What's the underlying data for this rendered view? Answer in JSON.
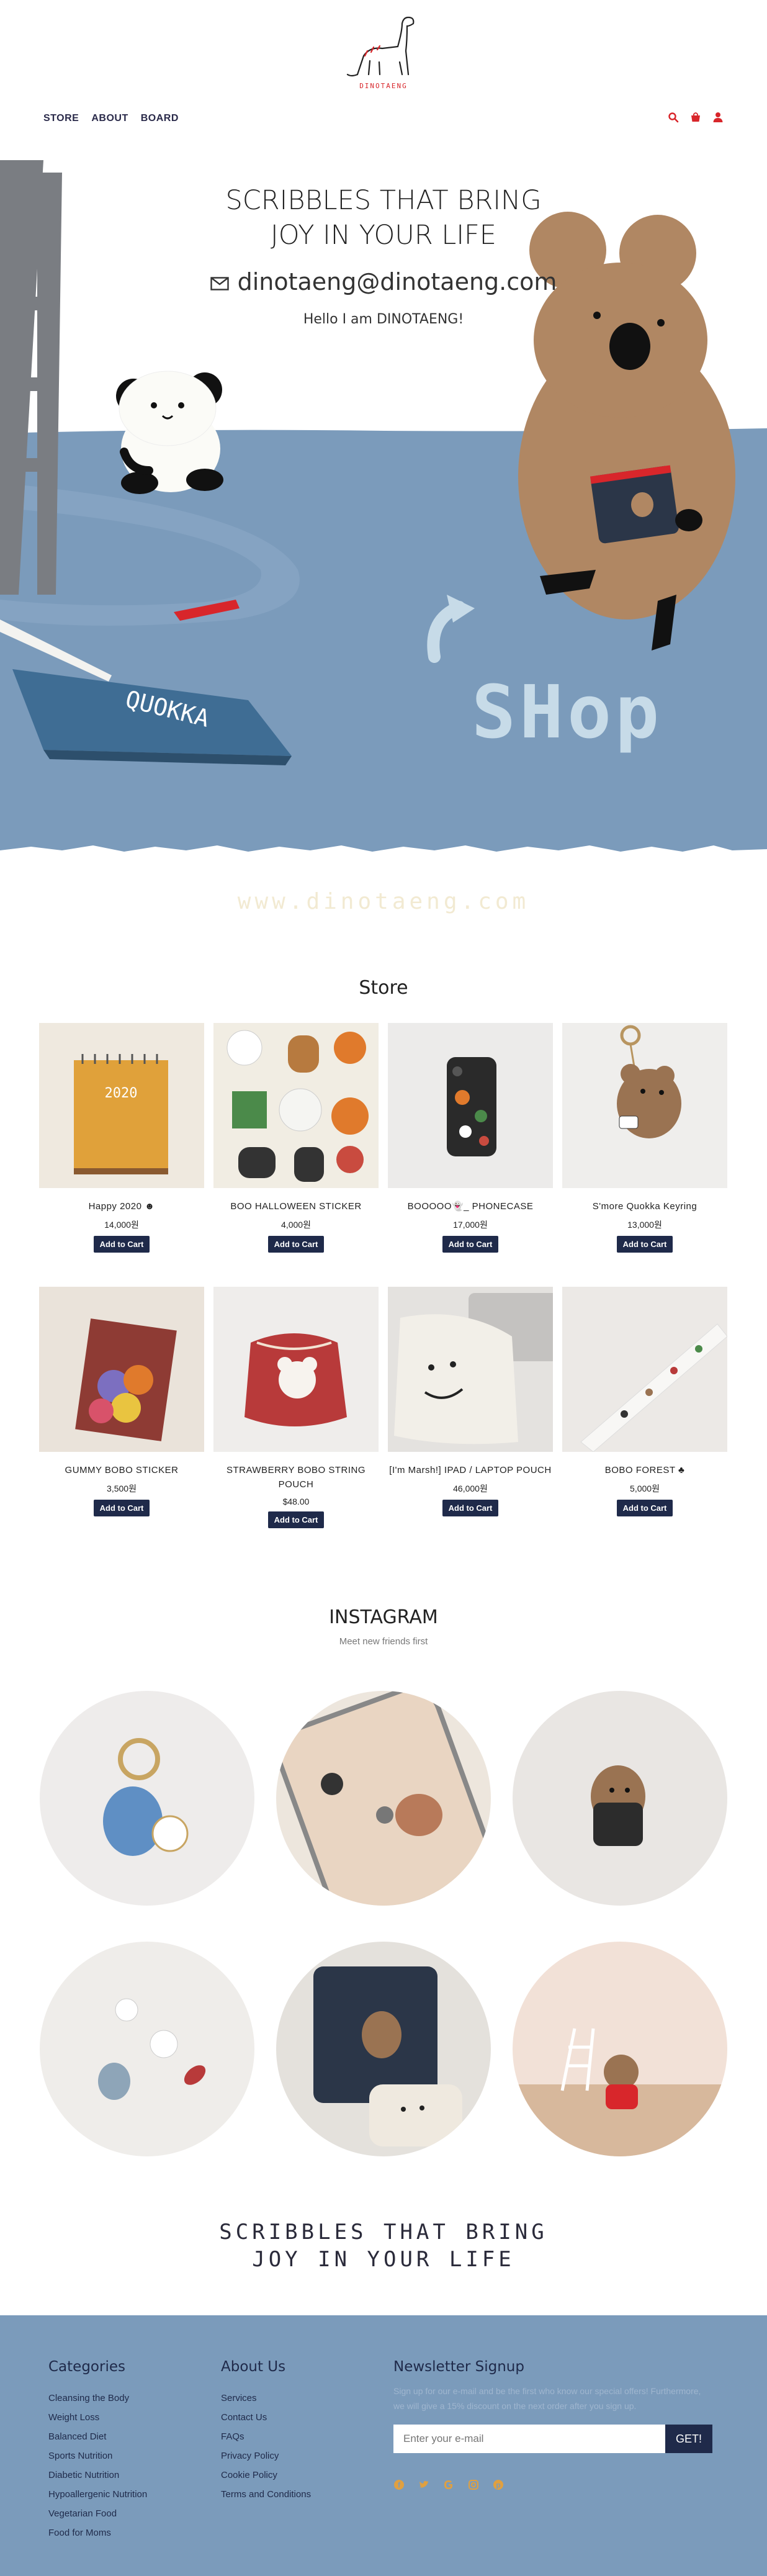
{
  "header": {
    "logo_text": "DINOTAENG",
    "nav": [
      "STORE",
      "ABOUT",
      "BOARD"
    ],
    "icons": [
      "search-icon",
      "cart-icon",
      "user-icon"
    ]
  },
  "hero": {
    "title_line1": "SCRIBBLES THAT BRING",
    "title_line2": "JOY IN YOUR LIFE",
    "email": "dinotaeng@dinotaeng.com",
    "hello": "Hello I am DINOTAENG!",
    "shop_text": "SHop",
    "notebook_text": "QUOKKA",
    "watermark": "www.dinotaeng.com"
  },
  "store": {
    "title": "Store",
    "button_label": "Add to Cart",
    "products": [
      {
        "name": "Happy 2020 ☻",
        "price": "14,000원"
      },
      {
        "name": "BOO HALLOWEEN STICKER",
        "price": "4,000원"
      },
      {
        "name": "BOOOOO👻_ PHONECASE",
        "price": "17,000원"
      },
      {
        "name": "S'more Quokka Keyring",
        "price": "13,000원"
      },
      {
        "name": "GUMMY BOBO STICKER",
        "price": "3,500원"
      },
      {
        "name": "STRAWBERRY BOBO STRING POUCH",
        "price": "$48.00"
      },
      {
        "name": "[I'm Marsh!] IPAD / LAPTOP POUCH",
        "price": "46,000원"
      },
      {
        "name": "BOBO FOREST ♣",
        "price": "5,000원"
      }
    ]
  },
  "instagram": {
    "title": "INSTAGRAM",
    "subtitle": "Meet new friends first"
  },
  "tagline": {
    "line1": "SCRIBBLES THAT BRING",
    "line2": "JOY IN YOUR LIFE"
  },
  "footer": {
    "categories_title": "Categories",
    "categories": [
      "Cleansing the Body",
      "Weight Loss",
      "Balanced Diet",
      "Sports Nutrition",
      "Diabetic Nutrition",
      "Hypoallergenic Nutrition",
      "Vegetarian Food",
      "Food for Moms"
    ],
    "about_title": "About Us",
    "about": [
      "Services",
      "Contact Us",
      "FAQs",
      "Privacy Policy",
      "Cookie Policy",
      "Terms and Conditions"
    ],
    "newsletter_title": "Newsletter Signup",
    "newsletter_text": "Sign up for our e-mail and be the first who know our special offers! Furthermore, we will give a 15% discount on the next order after you sign up.",
    "email_placeholder": "Enter your e-mail",
    "submit_label": "GET!",
    "social": [
      "facebook-icon",
      "twitter-icon",
      "google-icon",
      "instagram-icon",
      "pinterest-icon"
    ]
  },
  "colors": {
    "hero_blue": "#7b9bbb",
    "navy": "#1f2a4a",
    "accent_red": "#d8262b",
    "quokka_brown": "#b08763"
  }
}
